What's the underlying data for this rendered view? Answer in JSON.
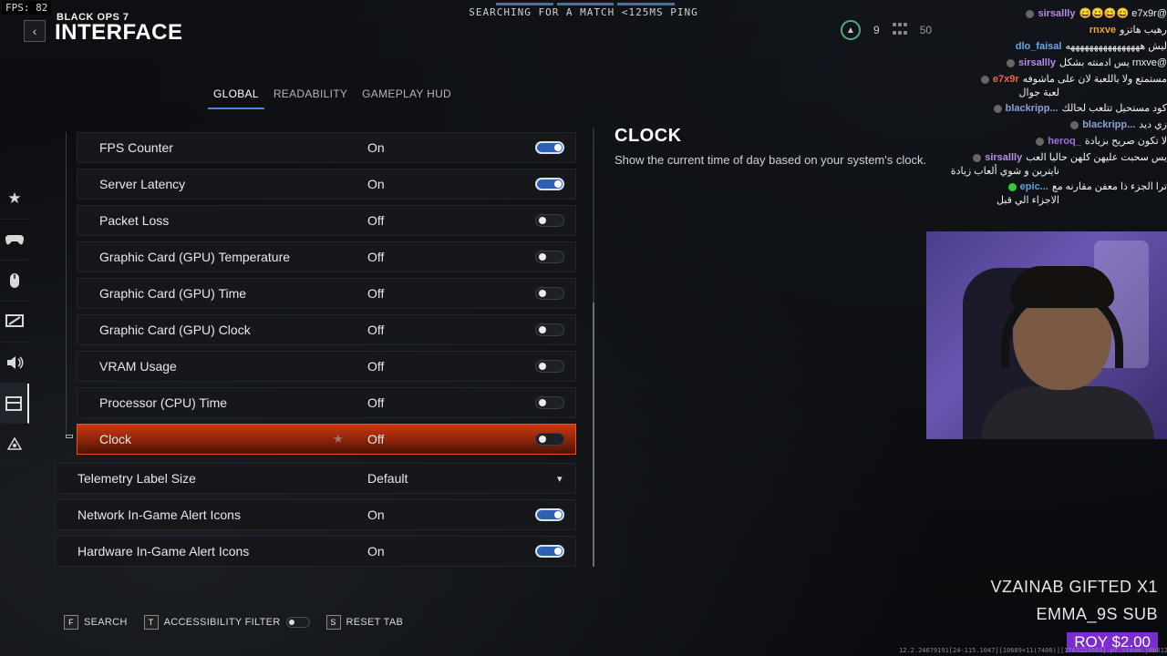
{
  "hud": {
    "fps_label": "FPS:",
    "fps_value": "82",
    "match_status": "SEARCHING FOR A MATCH <125MS PING",
    "level": "9",
    "cap_count": "50"
  },
  "header": {
    "brand": "BLACK OPS 7",
    "title": "INTERFACE",
    "back_label": "‹"
  },
  "tabs": [
    {
      "label": "GLOBAL",
      "active": true
    },
    {
      "label": "READABILITY",
      "active": false
    },
    {
      "label": "GAMEPLAY HUD",
      "active": false
    }
  ],
  "sidenav": [
    "star-icon",
    "controller-icon",
    "mouse-icon",
    "display-icon",
    "audio-icon",
    "interface-icon",
    "network-icon"
  ],
  "settings": [
    {
      "label": "FPS Counter",
      "value": "On",
      "control": "toggle",
      "state": "on"
    },
    {
      "label": "Server Latency",
      "value": "On",
      "control": "toggle",
      "state": "on"
    },
    {
      "label": "Packet Loss",
      "value": "Off",
      "control": "toggle",
      "state": "off"
    },
    {
      "label": "Graphic Card (GPU) Temperature",
      "value": "Off",
      "control": "toggle",
      "state": "off"
    },
    {
      "label": "Graphic Card (GPU) Time",
      "value": "Off",
      "control": "toggle",
      "state": "off"
    },
    {
      "label": "Graphic Card (GPU) Clock",
      "value": "Off",
      "control": "toggle",
      "state": "off"
    },
    {
      "label": "VRAM Usage",
      "value": "Off",
      "control": "toggle",
      "state": "off"
    },
    {
      "label": "Processor (CPU) Time",
      "value": "Off",
      "control": "toggle",
      "state": "off"
    },
    {
      "label": "Clock",
      "value": "Off",
      "control": "toggle",
      "state": "off",
      "selected": true,
      "star": "★"
    },
    {
      "label": "Telemetry Label Size",
      "value": "Default",
      "control": "dropdown"
    },
    {
      "label": "Network In-Game Alert Icons",
      "value": "On",
      "control": "toggle",
      "state": "on"
    },
    {
      "label": "Hardware In-Game Alert Icons",
      "value": "On",
      "control": "toggle",
      "state": "on"
    }
  ],
  "description": {
    "title": "CLOCK",
    "text": "Show the current time of day based on your system's clock."
  },
  "chat": [
    {
      "user": "sirsallly",
      "color": "#b98ce6",
      "msg": "@e7x9r 😄😄😄😄"
    },
    {
      "user": "rnxve",
      "color": "#e8a33c",
      "msg": "رهيب هاتزو"
    },
    {
      "user": "dlo_faisal",
      "color": "#6aa8e8",
      "msg": "ليش ههههههههههههههههه"
    },
    {
      "user": "sirsallly",
      "color": "#b98ce6",
      "msg": "@rnxve يس ادمنته بشكل"
    },
    {
      "user": "e7x9r",
      "color": "#e86a4a",
      "msg": "مستمتع ولا باللعبة لان على ماشوفه",
      "cont": "لعبة جوال"
    },
    {
      "user": "blackripp...",
      "color": "#8f9fd8",
      "msg": "كود مستحيل تتلعب لحالك"
    },
    {
      "user": "blackripp...",
      "color": "#8f9fd8",
      "msg": "زي ديد"
    },
    {
      "user": "heroq_",
      "color": "#a070d8",
      "msg": "لا تكون صريح بزيادة"
    },
    {
      "user": "sirsallly",
      "color": "#b98ce6",
      "msg": "يس سحبت عليهن كلهن حاليا العب",
      "cont": "نايترين و شوي ألعاب زيادة"
    },
    {
      "user": "epic...",
      "color": "#5fa2d8",
      "msg": "ترا الجزء ذا معفن مقارنه مع",
      "cont": "الاجزاء الي قبل"
    }
  ],
  "alerts": [
    {
      "text": "VZAINAB  GIFTED X1"
    },
    {
      "text": "EMMA_9S  SUB"
    }
  ],
  "donation": "ROY  $2.00",
  "footer": {
    "search_key": "F",
    "search_label": "SEARCH",
    "filter_key": "T",
    "filter_label": "ACCESSIBILITY FILTER",
    "reset_key": "S",
    "reset_label": "RESET TAB"
  },
  "debug": "12.2.24679191[24-115.1047][10689+11(7400)][1763229603].pc.steam.j0b01227rrvun"
}
